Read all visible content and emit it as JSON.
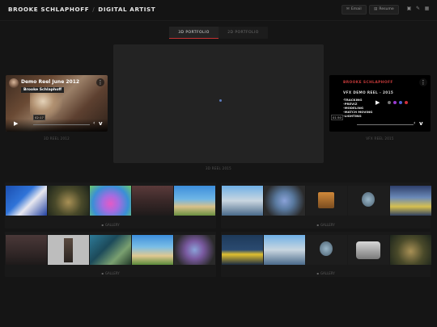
{
  "header": {
    "name": "BROOKE SCHLAPHOFF",
    "separator": "/",
    "role": "DIGITAL ARTIST",
    "email_label": "Email",
    "resume_label": "Resume"
  },
  "tabs": [
    {
      "label": "3D PORTFOLIO",
      "active": true
    },
    {
      "label": "2D PORTFOLIO",
      "active": false
    }
  ],
  "reels": {
    "left": {
      "title": "Demo Reel June 2012",
      "owner": "Brooke Schlaphoff",
      "time": "02:17",
      "caption": "3D REEL 2012"
    },
    "center": {
      "caption": "3D REEL 2015"
    },
    "right": {
      "heading": "BROOKE SCHLAPHOFF",
      "subtitle": "VFX DEMO REEL - 2015",
      "list": [
        "-TRACKING",
        "-PREVIZ",
        "-MODELING",
        "-MATCH MOVING",
        "-LIGHTING"
      ],
      "time": "01:50",
      "caption": "VFX REEL 2015"
    }
  },
  "galleries": [
    {
      "label": "GALLERY",
      "thumbs": [
        "sonic-character",
        "fantasy-creature-scene",
        "pink-blob-characters",
        "dark-tree-scene",
        "beach-island-scene"
      ]
    },
    {
      "label": "GALLERY",
      "thumbs": [
        "building-3d",
        "gem-cluster",
        "robot-on-box",
        "metal-gear-object",
        "arcade-machine"
      ]
    },
    {
      "label": "GALLERY",
      "thumbs": [
        "dark-tree-scene-2",
        "robot-tower",
        "green-warrior-character",
        "beach-scene-2",
        "gem-cluster-2"
      ]
    },
    {
      "label": "GALLERY",
      "thumbs": [
        "yellow-sign-scene",
        "building-3d-2",
        "metal-gear-object-2",
        "toaster-object",
        "fantasy-creature-scene-2"
      ]
    }
  ],
  "colors": {
    "accent": "#c23333",
    "background": "#151515"
  }
}
